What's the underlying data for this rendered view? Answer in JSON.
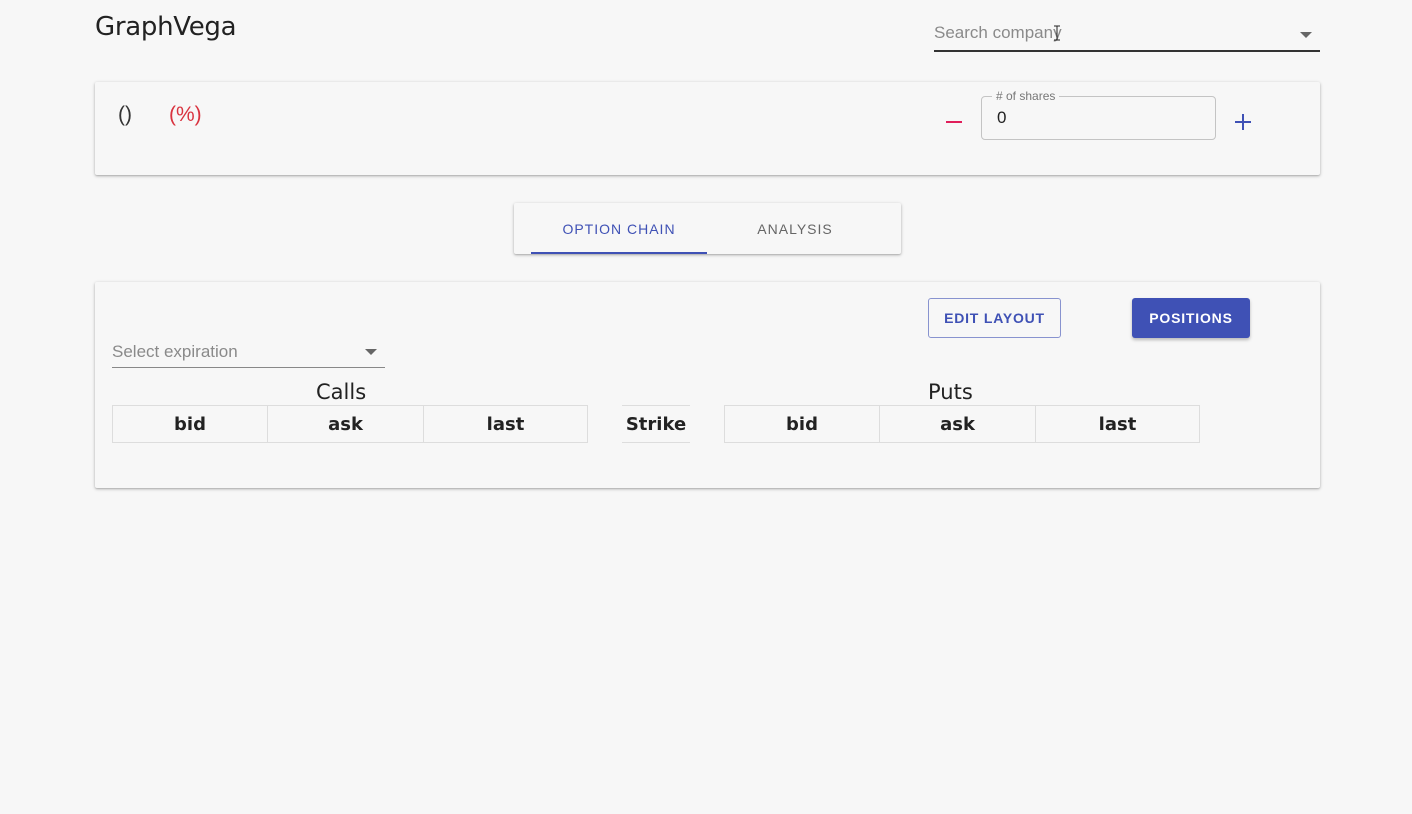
{
  "app": {
    "title": "GraphVega"
  },
  "search": {
    "placeholder": "Search company"
  },
  "quote": {
    "price": "()",
    "percent_change": "(%)"
  },
  "shares": {
    "label": "# of shares",
    "value": "0"
  },
  "tabs": [
    {
      "label": "OPTION CHAIN",
      "active": true
    },
    {
      "label": "ANALYSIS",
      "active": false
    }
  ],
  "toolbar": {
    "edit_layout_label": "EDIT LAYOUT",
    "positions_label": "POSITIONS"
  },
  "expiration": {
    "placeholder": "Select expiration"
  },
  "chain": {
    "calls_title": "Calls",
    "puts_title": "Puts",
    "strike_header": "Strike",
    "calls_headers": [
      "bid",
      "ask",
      "last"
    ],
    "puts_headers": [
      "bid",
      "ask",
      "last"
    ]
  },
  "colors": {
    "primary": "#3f51b5",
    "negative": "#d9333f",
    "minus": "#e01e5a"
  },
  "icons": {
    "search_dropdown": "caret-down-icon",
    "cursor": "text-cursor-icon"
  }
}
